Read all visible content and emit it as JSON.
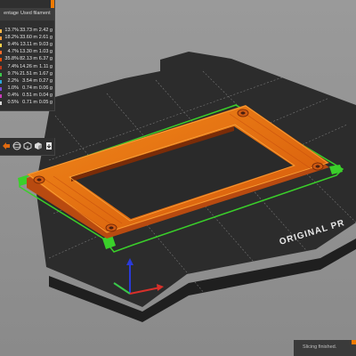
{
  "legend": {
    "headers": {
      "percentage": "entage",
      "used_filament": "Used filament"
    },
    "rows": [
      {
        "pct": "13.7%",
        "length": "33.73 m",
        "weight": "2.42 g",
        "color": "#ffb84a"
      },
      {
        "pct": "18.2%",
        "length": "33.60 m",
        "weight": "2.61 g",
        "color": "#ff9a3a"
      },
      {
        "pct": "9.4%",
        "length": "13.11 m",
        "weight": "9.03 g",
        "color": "#ffd24a"
      },
      {
        "pct": "4.7%",
        "length": "13.30 m",
        "weight": "1.03 g",
        "color": "#ff6a2a"
      },
      {
        "pct": "35.8%",
        "length": "82.13 m",
        "weight": "6.37 g",
        "color": "#f04a00"
      },
      {
        "pct": "7.4%",
        "length": "14.26 m",
        "weight": "1.11 g",
        "color": "#c03a1a"
      },
      {
        "pct": "9.7%",
        "length": "21.51 m",
        "weight": "1.67 g",
        "color": "#3ac84a"
      },
      {
        "pct": "2.2%",
        "length": "3.54 m",
        "weight": "0.27 g",
        "color": "#2aa8d8"
      },
      {
        "pct": "1.0%",
        "length": "0.74 m",
        "weight": "0.06 g",
        "color": "#7a4ad8"
      },
      {
        "pct": "0.4%",
        "length": "0.51 m",
        "weight": "0.04 g",
        "color": "#c83ab8"
      },
      {
        "pct": "0.5%",
        "length": "0.71 m",
        "weight": "0.05 g",
        "color": "#d8d8d8"
      }
    ]
  },
  "toolbar": {
    "icons": [
      "arrow-icon",
      "sphere-icon",
      "cube-icon",
      "cube-outline-icon",
      "export-icon"
    ]
  },
  "bed": {
    "brand_text": "ORIGINAL PR",
    "colors": {
      "bed": "#3a3a3a",
      "bed_top": "#2c2c2c",
      "perimeter": "#f07a00",
      "infill": "#e05a10",
      "skirt": "#3ad02a"
    }
  },
  "status": {
    "text": "Slicing finished."
  }
}
